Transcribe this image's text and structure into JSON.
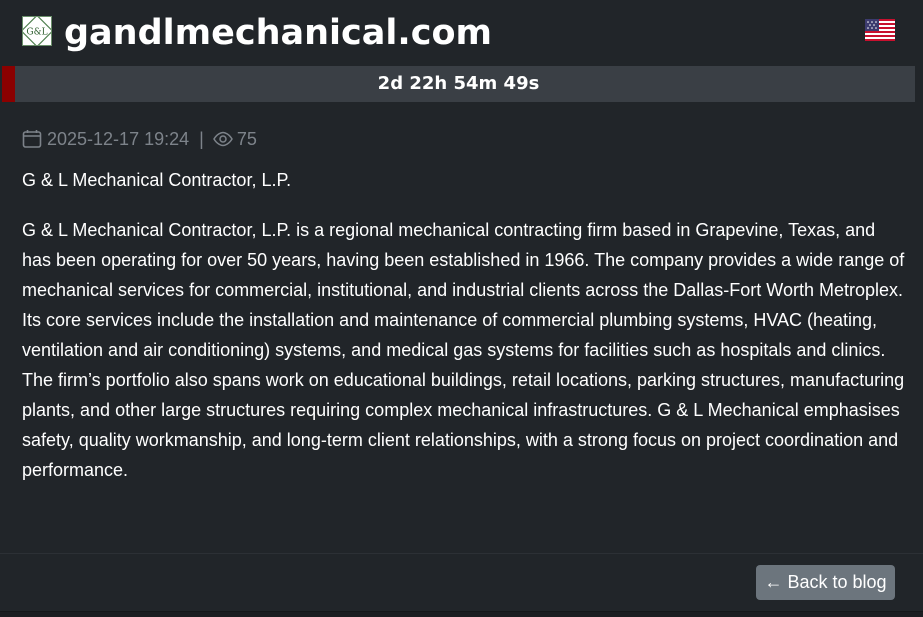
{
  "header": {
    "logo_icon": "gl-logo-icon",
    "logo_text": "G&L",
    "domain": "gandlmechanical.com",
    "flag_icon": "us-flag-icon"
  },
  "countdown": {
    "text": "2d 22h 54m 49s",
    "accent_color": "#8b0000"
  },
  "meta": {
    "date_icon": "calendar-icon",
    "date": "2025-12-17 19:24",
    "separator": "|",
    "views_icon": "eye-icon",
    "views": "75"
  },
  "post": {
    "subtitle": "G & L Mechanical Contractor, L.P.",
    "body": "G & L Mechanical Contractor, L.P. is a regional mechanical contracting firm based in Grapevine, Texas, and has been operating for over 50 years, having been established in 1966. The company provides a wide range of mechanical services for commercial, institutional, and industrial clients across the Dallas-Fort Worth Metroplex. Its core services include the installation and maintenance of commercial plumbing systems, HVAC (heating, ventilation and air conditioning) systems, and medical gas systems for facilities such as hospitals and clinics. The firm’s portfolio also spans work on educational buildings, retail locations, parking structures, manufacturing plants, and other large structures requiring complex mechanical infrastructures. G & L Mechanical emphasises safety, quality workmanship, and long-term client relationships, with a strong focus on project coordination and performance."
  },
  "footer": {
    "back_label": "← Back to blog",
    "button_color": "#6c757d"
  }
}
